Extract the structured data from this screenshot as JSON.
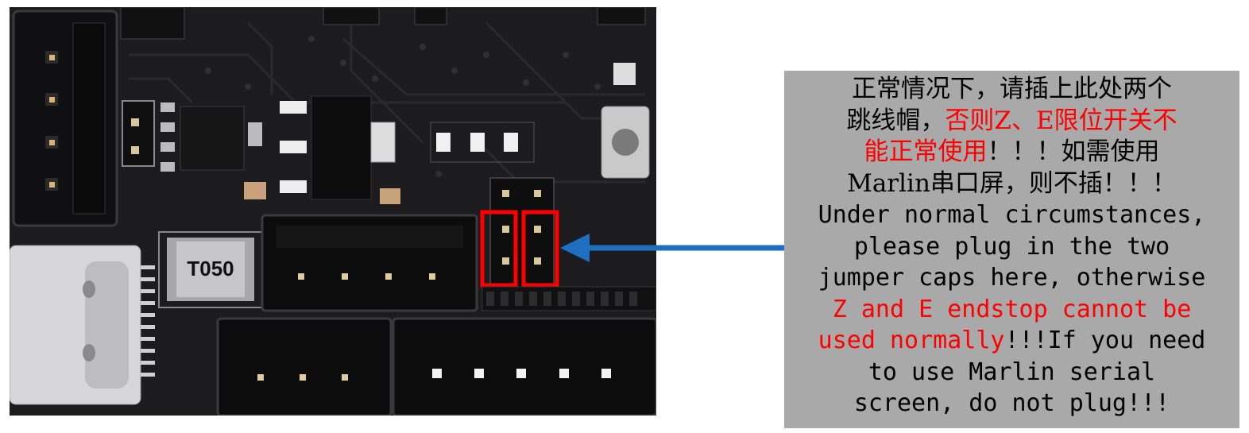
{
  "photo": {
    "component_label": "T050"
  },
  "note": {
    "line1": "正常情况下，请插上此处两个",
    "line2_a": "跳线帽，",
    "line2_b": "否则Z、E限位开关不",
    "line3_a": "能正常使用",
    "line3_b": "！！！如需使用",
    "line4": "Marlin串口屏，则不插！！！",
    "line5": "Under normal circumstances,",
    "line6": "please plug in the two",
    "line7": "jumper caps here, otherwise",
    "line8": "Z and E endstop cannot be",
    "line9_a": "used normally",
    "line9_b": "!!!If you need",
    "line10": "to use Marlin serial",
    "line11": "screen, do not plug!!!"
  },
  "colors": {
    "highlight": "#ff0000",
    "arrow": "#1f6fc1",
    "note_background": "#a9a9a9",
    "board": "#1b1b1d"
  }
}
